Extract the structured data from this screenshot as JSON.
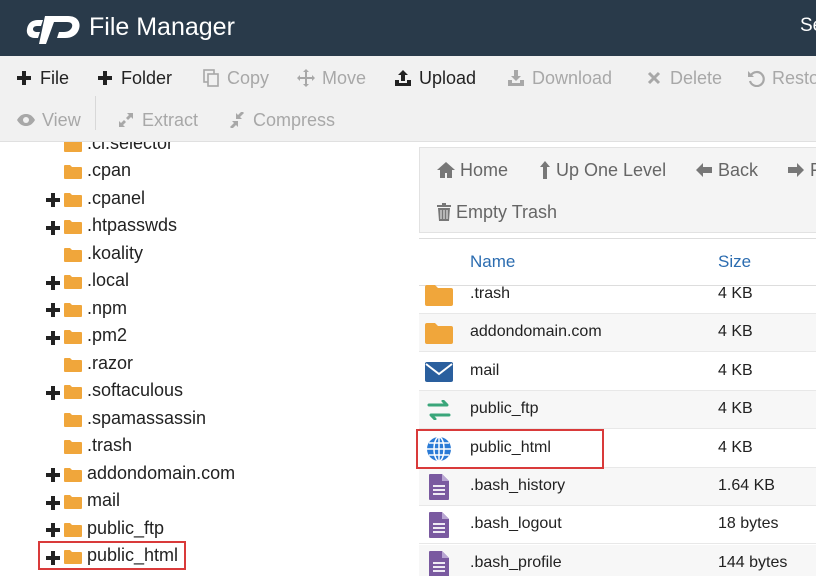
{
  "header": {
    "title": "File Manager",
    "right_text": "Se"
  },
  "toolbar": {
    "file": "File",
    "folder": "Folder",
    "copy": "Copy",
    "move": "Move",
    "upload": "Upload",
    "download": "Download",
    "delete": "Delete",
    "restore": "Resto",
    "view": "View",
    "extract": "Extract",
    "compress": "Compress"
  },
  "tree": {
    "items": [
      {
        "label": ".cl.selector",
        "expandable": false
      },
      {
        "label": ".cpan",
        "expandable": false
      },
      {
        "label": ".cpanel",
        "expandable": true
      },
      {
        "label": ".htpasswds",
        "expandable": true
      },
      {
        "label": ".koality",
        "expandable": false
      },
      {
        "label": ".local",
        "expandable": true
      },
      {
        "label": ".npm",
        "expandable": true
      },
      {
        "label": ".pm2",
        "expandable": true
      },
      {
        "label": ".razor",
        "expandable": false
      },
      {
        "label": ".softaculous",
        "expandable": true
      },
      {
        "label": ".spamassassin",
        "expandable": false
      },
      {
        "label": ".trash",
        "expandable": false
      },
      {
        "label": "addondomain.com",
        "expandable": true
      },
      {
        "label": "mail",
        "expandable": true
      },
      {
        "label": "public_ftp",
        "expandable": true
      },
      {
        "label": "public_html",
        "expandable": true
      }
    ]
  },
  "nav": {
    "home": "Home",
    "up": "Up One Level",
    "back": "Back",
    "forward": "F",
    "empty_trash": "Empty Trash"
  },
  "table": {
    "col_name": "Name",
    "col_size": "Size",
    "rows": [
      {
        "name": ".trash",
        "size": "4 KB",
        "icon": "folder-icon"
      },
      {
        "name": "addondomain.com",
        "size": "4 KB",
        "icon": "folder-icon"
      },
      {
        "name": "mail",
        "size": "4 KB",
        "icon": "mail-icon"
      },
      {
        "name": "public_ftp",
        "size": "4 KB",
        "icon": "transfer-icon"
      },
      {
        "name": "public_html",
        "size": "4 KB",
        "icon": "globe-icon"
      },
      {
        "name": ".bash_history",
        "size": "1.64 KB",
        "icon": "document-icon"
      },
      {
        "name": ".bash_logout",
        "size": "18 bytes",
        "icon": "document-icon"
      },
      {
        "name": ".bash_profile",
        "size": "144 bytes",
        "icon": "document-icon"
      }
    ]
  },
  "colors": {
    "header_bg": "#293a4a",
    "folder": "#f0a63b",
    "link_blue": "#2b6cb0",
    "highlight_red": "#d93a3a",
    "mail_blue": "#2a5f9e",
    "transfer_green": "#3aa67a",
    "doc_purple": "#7a5aa0"
  }
}
